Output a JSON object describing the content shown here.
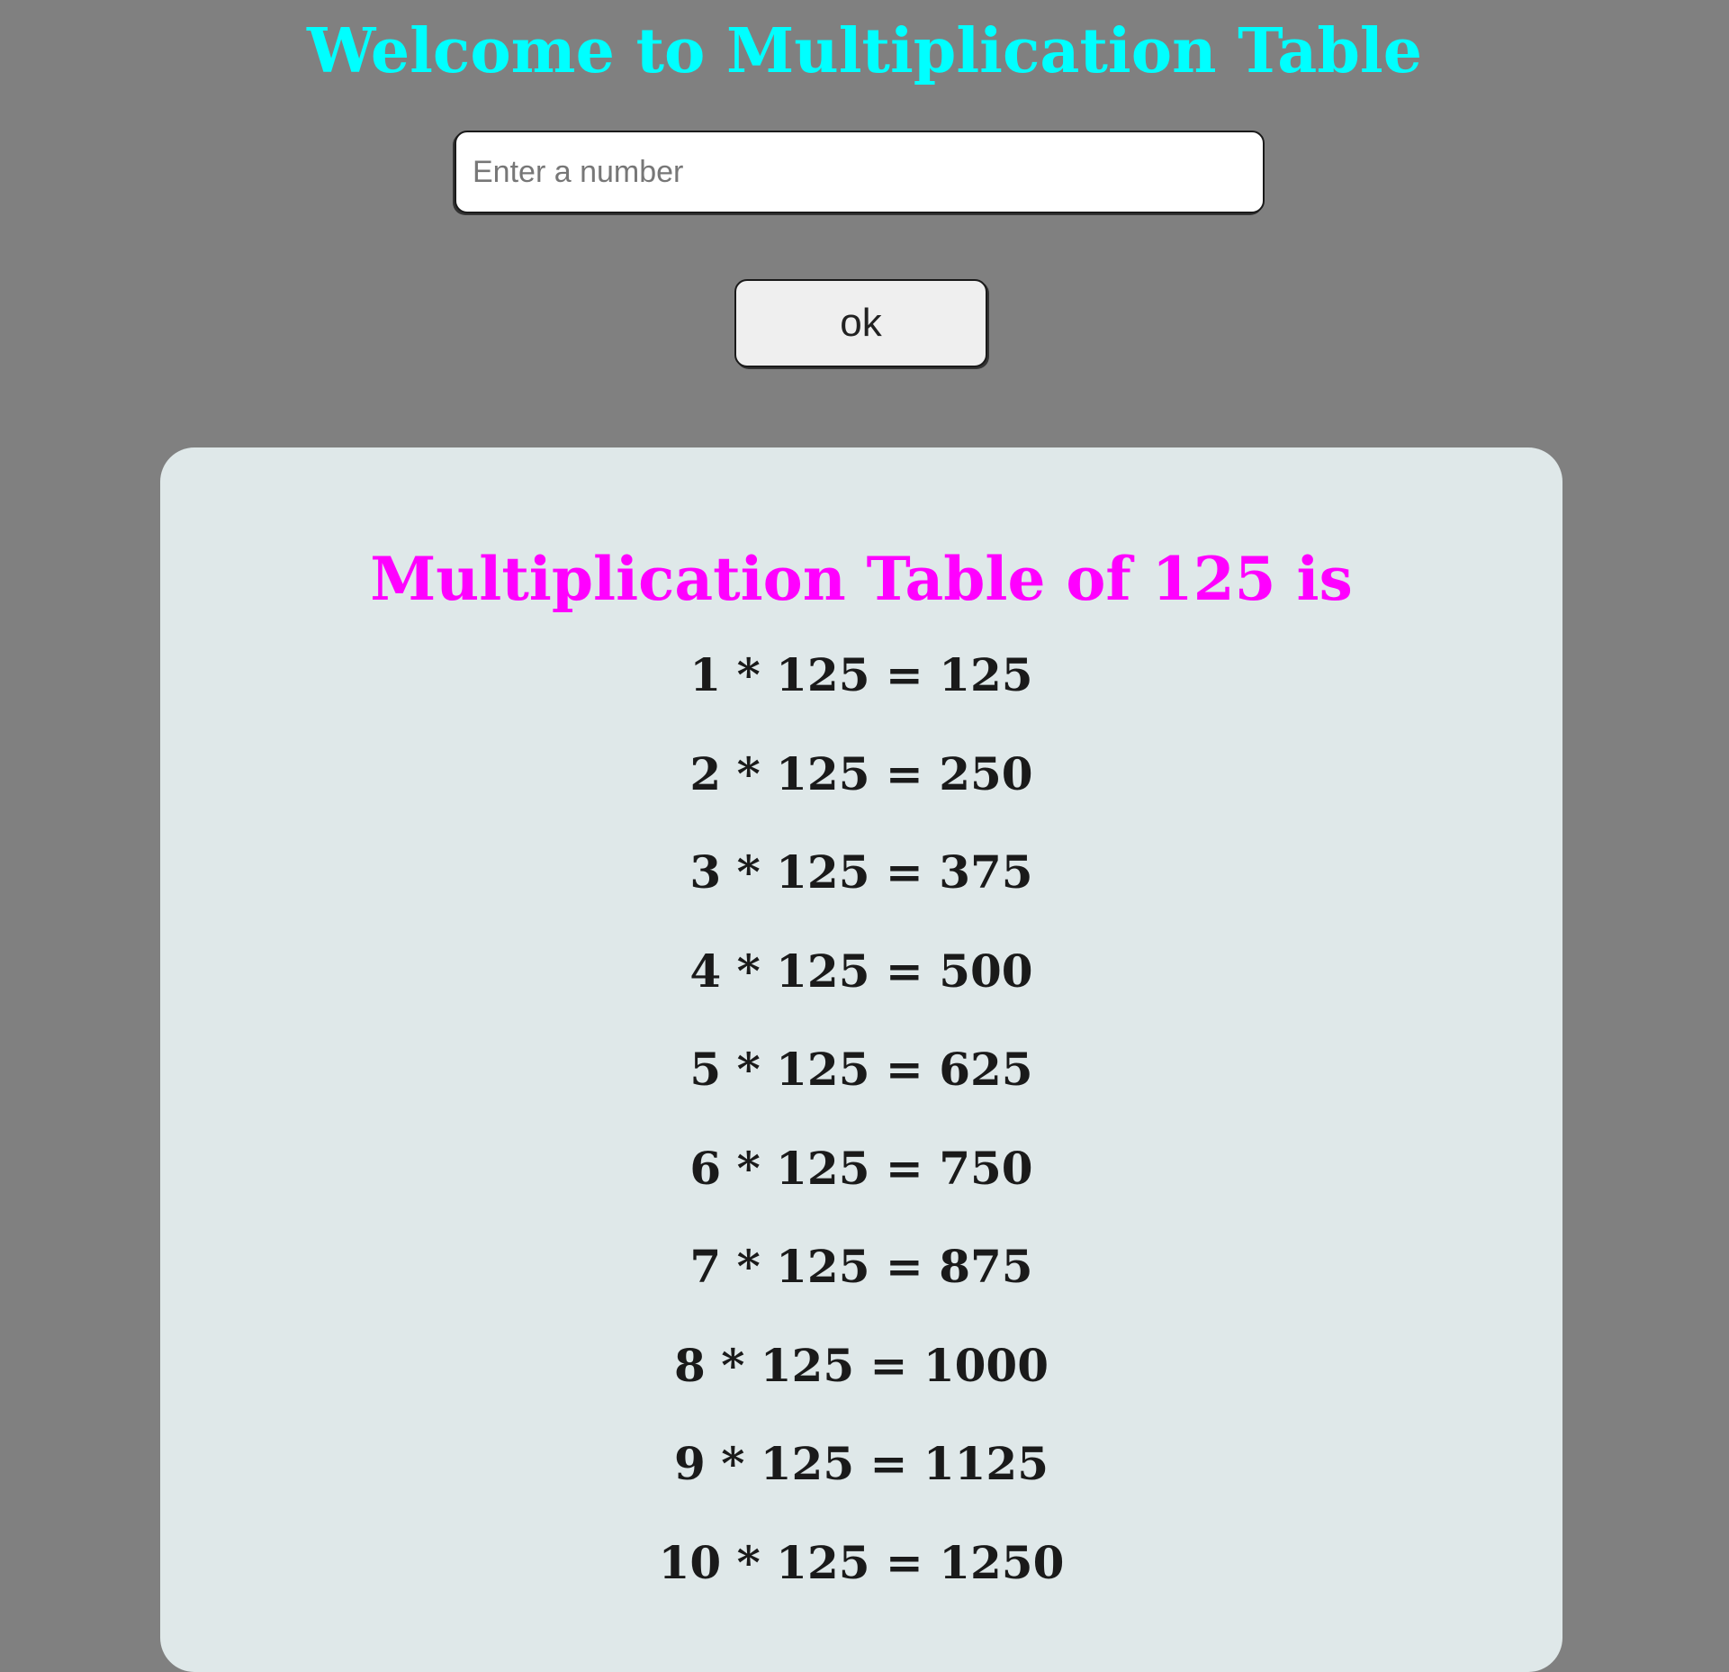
{
  "header": {
    "title": "Welcome to Multiplication Table"
  },
  "input": {
    "placeholder": "Enter a number",
    "value": ""
  },
  "button": {
    "label": "ok"
  },
  "result": {
    "heading": "Multiplication Table of 125 is",
    "rows": [
      "1 * 125 = 125",
      "2 * 125 = 250",
      "3 * 125 = 375",
      "4 * 125 = 500",
      "5 * 125 = 625",
      "6 * 125 = 750",
      "7 * 125 = 875",
      "8 * 125 = 1000",
      "9 * 125 = 1125",
      "10 * 125 = 1250"
    ]
  },
  "colors": {
    "background": "#808080",
    "title": "#00ffff",
    "heading": "#ff00ff",
    "card": "#dfe8e9"
  }
}
